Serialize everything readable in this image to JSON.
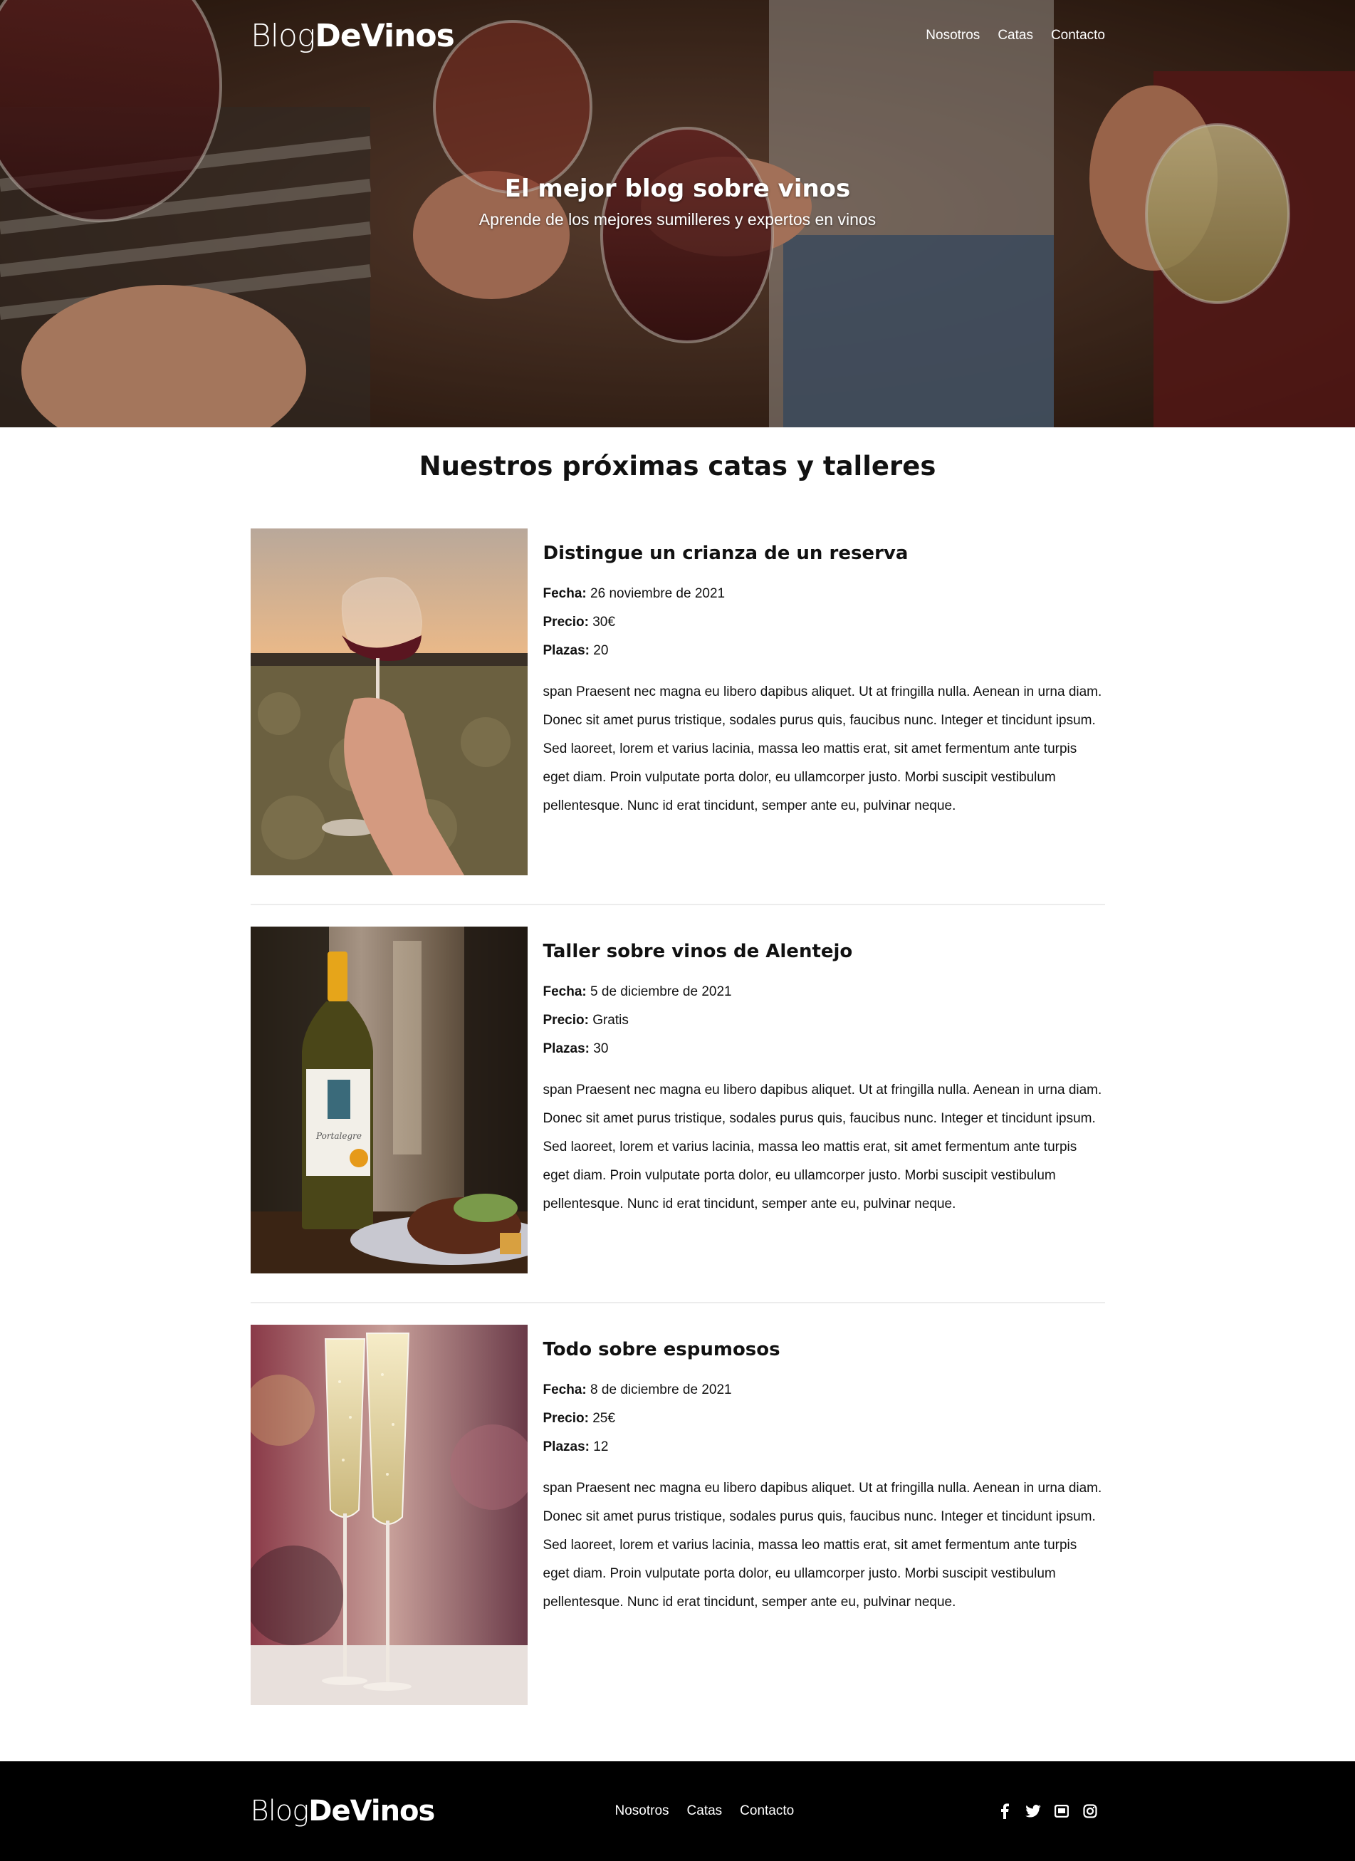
{
  "brand": {
    "light": "Blog",
    "bold": "DeVinos"
  },
  "nav": {
    "about": "Nosotros",
    "tastings": "Catas",
    "contact": "Contacto"
  },
  "hero": {
    "title": "El mejor blog sobre vinos",
    "subtitle": "Aprende de los mejores sumilleres y expertos en vinos"
  },
  "section": {
    "title": "Nuestros próximas catas y talleres"
  },
  "labels": {
    "date": "Fecha:",
    "price": "Precio:",
    "seats": "Plazas:"
  },
  "events": [
    {
      "title": "Distingue un crianza de un reserva",
      "date": "26 noviembre de 2021",
      "price": "30€",
      "seats": "20",
      "description": "span Praesent nec magna eu libero dapibus aliquet. Ut at fringilla nulla. Aenean in urna diam. Donec sit amet purus tristique, sodales purus quis, faucibus nunc. Integer et tincidunt ipsum. Sed laoreet, lorem et varius lacinia, massa leo mattis erat, sit amet fermentum ante turpis eget diam. Proin vulputate porta dolor, eu ullamcorper justo. Morbi suscipit vestibulum pellentesque. Nunc id erat tincidunt, semper ante eu, pulvinar neque."
    },
    {
      "title": "Taller sobre vinos de Alentejo",
      "date": "5 de diciembre de 2021",
      "price": "Gratis",
      "seats": "30",
      "description": "span Praesent nec magna eu libero dapibus aliquet. Ut at fringilla nulla. Aenean in urna diam. Donec sit amet purus tristique, sodales purus quis, faucibus nunc. Integer et tincidunt ipsum. Sed laoreet, lorem et varius lacinia, massa leo mattis erat, sit amet fermentum ante turpis eget diam. Proin vulputate porta dolor, eu ullamcorper justo. Morbi suscipit vestibulum pellentesque. Nunc id erat tincidunt, semper ante eu, pulvinar neque."
    },
    {
      "title": "Todo sobre espumosos",
      "date": "8 de diciembre de 2021",
      "price": "25€",
      "seats": "12",
      "description": "span Praesent nec magna eu libero dapibus aliquet. Ut at fringilla nulla. Aenean in urna diam. Donec sit amet purus tristique, sodales purus quis, faucibus nunc. Integer et tincidunt ipsum. Sed laoreet, lorem et varius lacinia, massa leo mattis erat, sit amet fermentum ante turpis eget diam. Proin vulputate porta dolor, eu ullamcorper justo. Morbi suscipit vestibulum pellentesque. Nunc id erat tincidunt, semper ante eu, pulvinar neque."
    }
  ],
  "footer": {
    "social_icons": [
      "facebook-icon",
      "twitter-icon",
      "youtube-icon",
      "instagram-icon"
    ]
  },
  "colors": {
    "footer_bg": "#000000",
    "divider": "#ececec",
    "text": "#111111"
  }
}
